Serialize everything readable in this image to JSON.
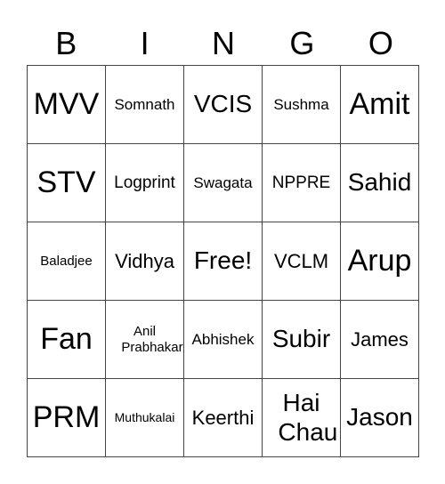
{
  "header": [
    "B",
    "I",
    "N",
    "G",
    "O"
  ],
  "cells": [
    "MVV",
    "Somnath",
    "VCIS",
    "Sushma",
    "Amit",
    "STV",
    "Logprint",
    "Swagata",
    "NPPRE",
    "Sahid",
    "Baladjee",
    "Vidhya",
    "Free!",
    "VCLM",
    "Arup",
    "Fan",
    "Anil Prabhakar",
    "Abhishek",
    "Subir",
    "James",
    "PRM",
    "Muthukalai",
    "Keerthi",
    "Hai Chau",
    "Jason"
  ]
}
